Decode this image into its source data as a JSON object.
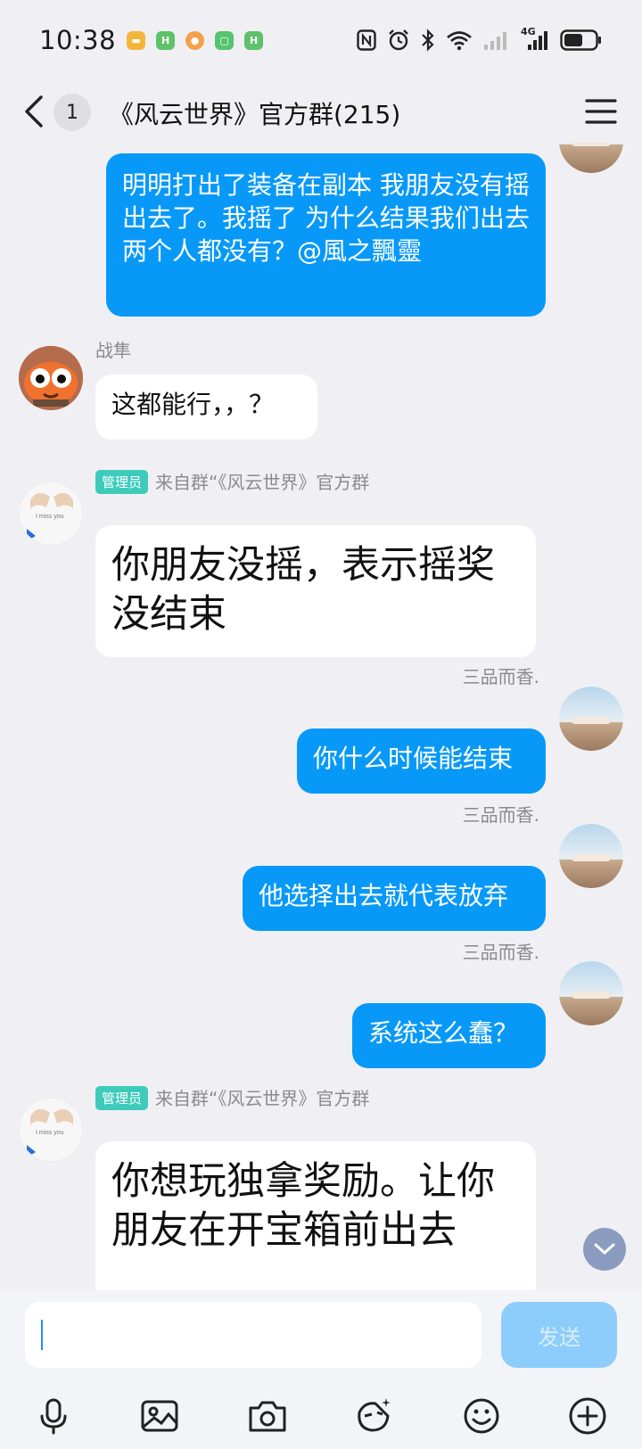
{
  "status": {
    "time": "10:38",
    "network": "4G"
  },
  "header": {
    "back_count": "1",
    "title": "《风云世界》官方群(215)"
  },
  "messages": [
    {
      "id": "m1",
      "side": "out",
      "text": "明明打出了装备在副本 我朋友没有摇出去了。我摇了 为什么结果我们出去两个人都没有？@風之飄靈"
    },
    {
      "id": "m2",
      "side": "in",
      "sender": "战隼",
      "text": "这都能行，，？"
    },
    {
      "id": "m3",
      "side": "in",
      "admin_tag": "管理员",
      "sender": "来自群“《风云世界》官方群",
      "text": "你朋友没摇，表示摇奖没结束"
    },
    {
      "id": "m4",
      "side": "out",
      "sender": "三品而香.",
      "text": "你什么时候能结束"
    },
    {
      "id": "m5",
      "side": "out",
      "sender": "三品而香.",
      "text": "他选择出去就代表放弃"
    },
    {
      "id": "m6",
      "side": "out",
      "sender": "三品而香.",
      "text": "系统这么蠢？"
    },
    {
      "id": "m7",
      "side": "in",
      "admin_tag": "管理员",
      "sender": "来自群“《风云世界》官方群",
      "text": "你想玩独拿奖励。让你朋友在开宝箱前出去"
    }
  ],
  "avatar_caption": "I miss you",
  "input": {
    "value": "",
    "send_label": "发送"
  },
  "colors": {
    "outgoing_bubble": "#0899f8",
    "incoming_bubble": "#ffffff",
    "admin_tag": "#3ecbbb",
    "send_button": "#8dcdfb"
  },
  "toolbar_icons": [
    "microphone-icon",
    "image-icon",
    "camera-icon",
    "sticker-icon",
    "emoji-icon",
    "plus-icon"
  ]
}
